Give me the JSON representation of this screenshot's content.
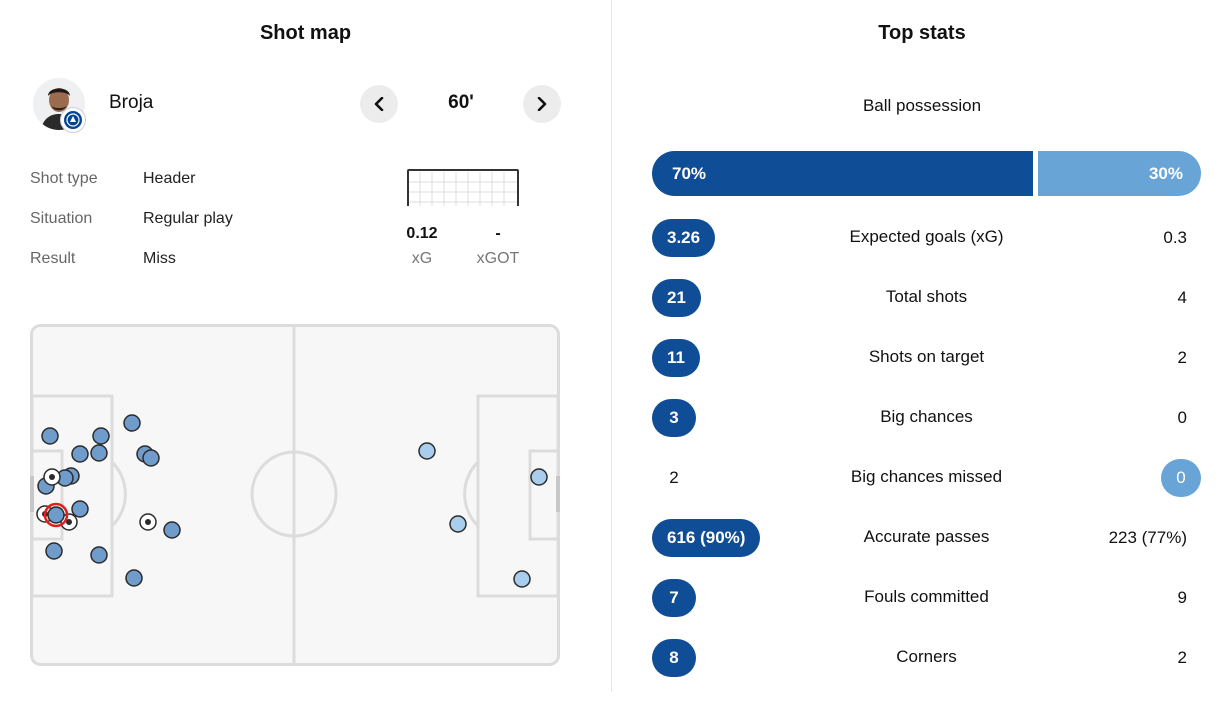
{
  "shot_map": {
    "title": "Shot map",
    "player": {
      "name": "Broja",
      "avatar_icon": "player-avatar-icon",
      "badge_icon": "chelsea-crest-icon"
    },
    "minute": "60'",
    "details": [
      {
        "label": "Shot type",
        "value": "Header"
      },
      {
        "label": "Situation",
        "value": "Regular play"
      },
      {
        "label": "Result",
        "value": "Miss"
      }
    ],
    "xg": {
      "value": "0.12",
      "label": "xG"
    },
    "xgot": {
      "value": "-",
      "label": "xGOT"
    }
  },
  "top_stats": {
    "title": "Top stats",
    "possession": {
      "label": "Ball possession",
      "home": "70%",
      "away": "30%",
      "home_fraction": 0.7
    },
    "rows": [
      {
        "name": "Expected goals (xG)",
        "home": "3.26",
        "away": "0.3",
        "leader": "home"
      },
      {
        "name": "Total shots",
        "home": "21",
        "away": "4",
        "leader": "home"
      },
      {
        "name": "Shots on target",
        "home": "11",
        "away": "2",
        "leader": "home"
      },
      {
        "name": "Big chances",
        "home": "3",
        "away": "0",
        "leader": "home"
      },
      {
        "name": "Big chances missed",
        "home": "2",
        "away": "0",
        "leader": "away"
      },
      {
        "name": "Accurate passes",
        "home": "616 (90%)",
        "away": "223 (77%)",
        "leader": "home"
      },
      {
        "name": "Fouls committed",
        "home": "7",
        "away": "9",
        "leader": "home"
      },
      {
        "name": "Corners",
        "home": "8",
        "away": "2",
        "leader": "home"
      }
    ]
  },
  "colors": {
    "home": "#0f4d96",
    "away": "#68a4d6",
    "home_shot": "#6f9cca",
    "away_shot": "#a9cdec",
    "selected": "#e01e1e"
  }
}
